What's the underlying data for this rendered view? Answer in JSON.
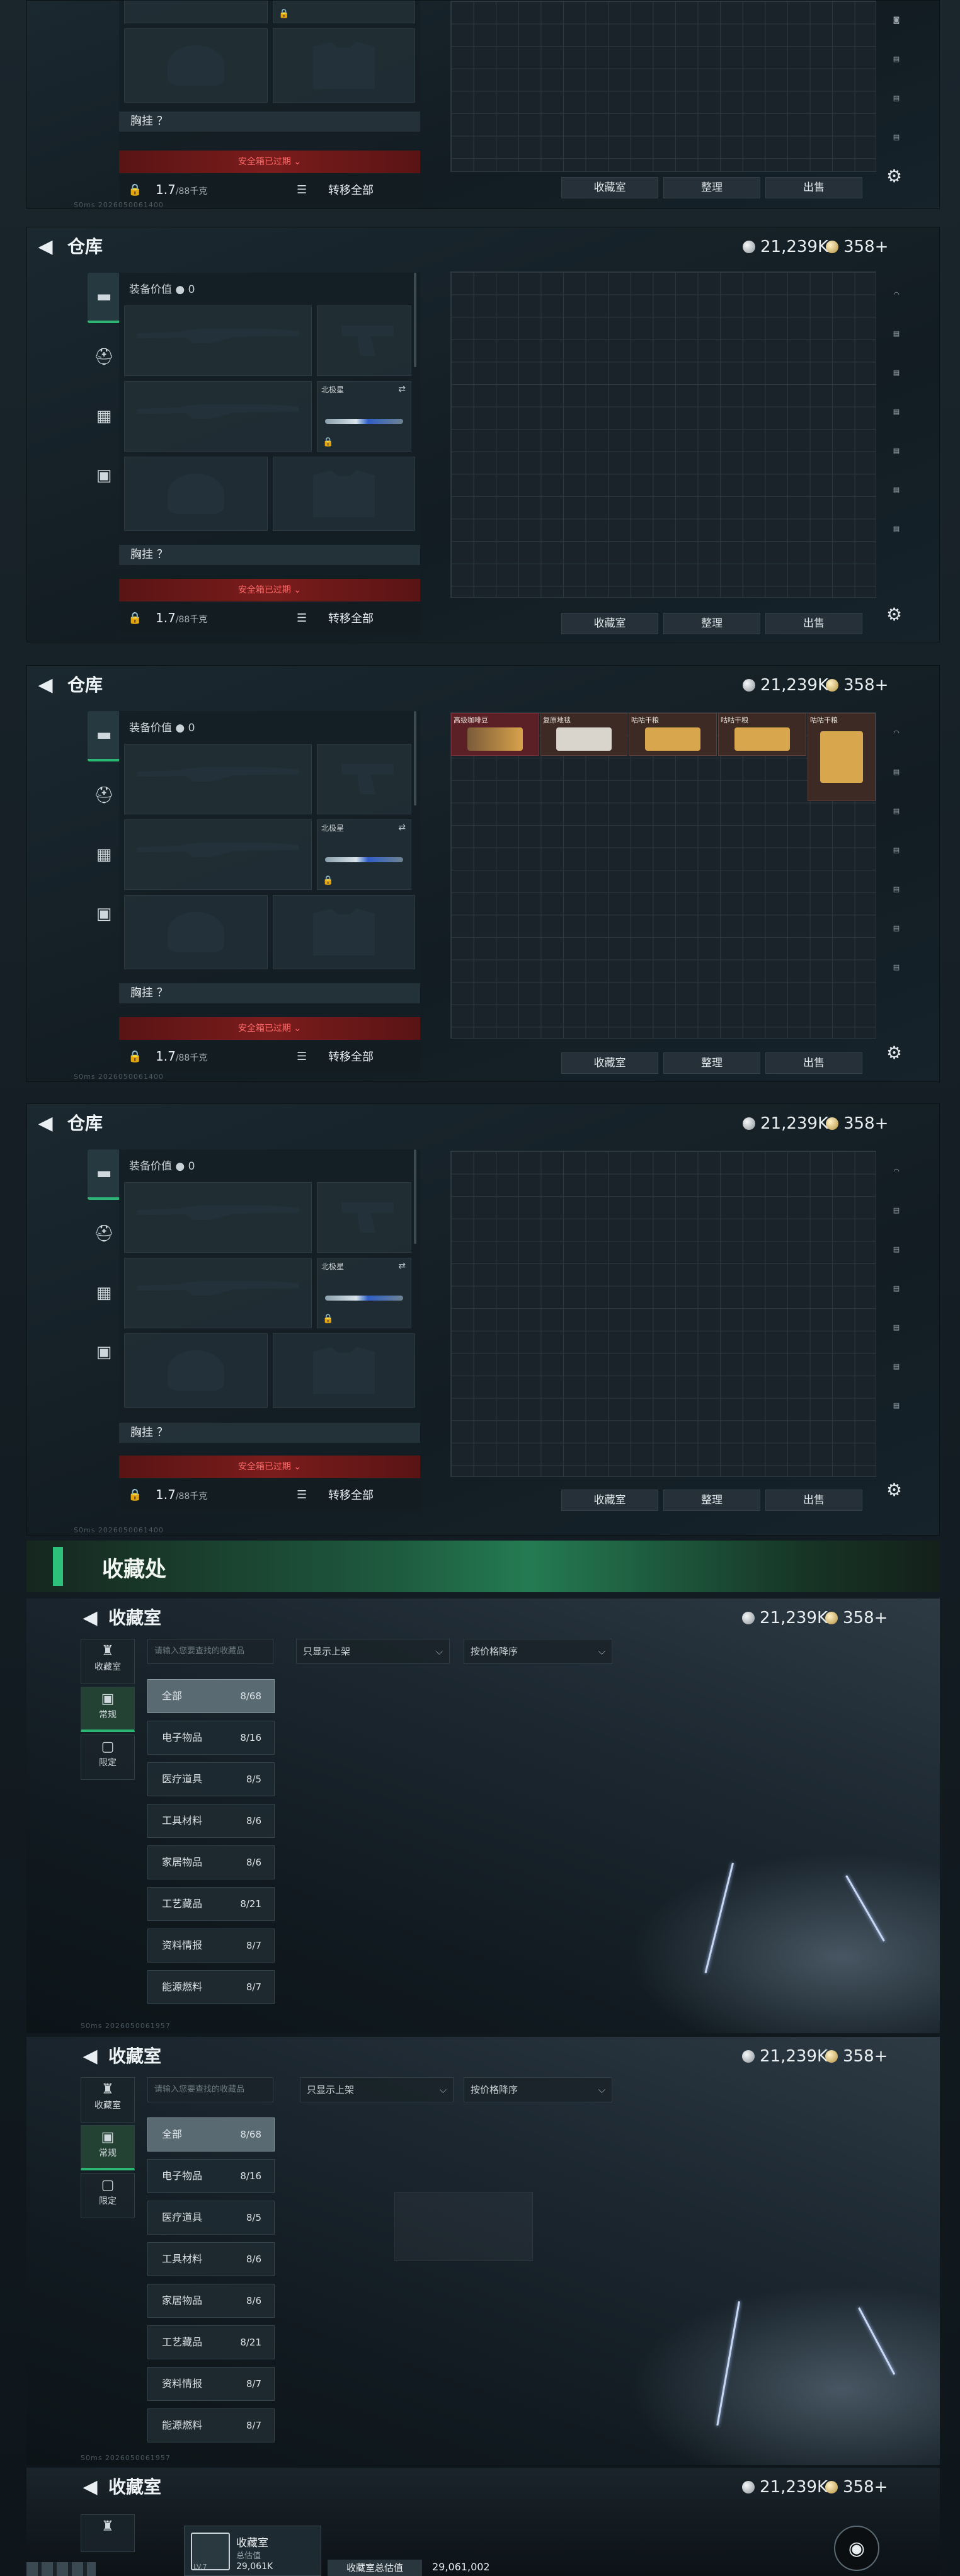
{
  "warehouse": {
    "title": "仓库",
    "silver": "21,239K",
    "gold": "358+",
    "equip_value_label": "装备价值",
    "equip_value": "0",
    "secondary_slot_label": "北极星",
    "chest_rig_label": "胸挂 ？",
    "safebox_alert": "安全箱已过期",
    "capacity": "1.7",
    "capacity_unit": "/88千克",
    "transfer_all": "转移全部",
    "btn_collection": "收藏室",
    "btn_sort": "整理",
    "btn_sell": "出售",
    "watermark": "S0ms 2026050061400"
  },
  "loot_items": [
    {
      "name": "高级咖啡豆"
    },
    {
      "name": "复原地毯"
    },
    {
      "name": "咕咕干粮"
    },
    {
      "name": "咕咕干粮"
    },
    {
      "name": "咕咕干粮"
    }
  ],
  "section_header": {
    "title": "收藏处"
  },
  "collection": {
    "title": "收藏室",
    "silver": "21,239K",
    "gold": "358+",
    "tabs": [
      {
        "label": "收藏室",
        "icon": "trophy-icon"
      },
      {
        "label": "常规",
        "icon": "image-icon"
      },
      {
        "label": "限定",
        "icon": "frame-icon"
      }
    ],
    "search_placeholder": "请输入您要查找的收藏品",
    "filter_shelf": "只显示上架",
    "sort_order": "按价格降序",
    "categories": [
      {
        "name": "全部",
        "count": "8/68"
      },
      {
        "name": "电子物品",
        "count": "8/16"
      },
      {
        "name": "医疗道具",
        "count": "8/5"
      },
      {
        "name": "工具材料",
        "count": "8/6"
      },
      {
        "name": "家居物品",
        "count": "8/6"
      },
      {
        "name": "工艺藏品",
        "count": "8/21"
      },
      {
        "name": "资料情报",
        "count": "8/7"
      },
      {
        "name": "能源燃料",
        "count": "8/7"
      }
    ],
    "watermark": "S0ms 2026050061957"
  },
  "final": {
    "title": "收藏室",
    "tile_name": "收藏室",
    "tile_sub": "总估值",
    "tile_value": "29,061K",
    "total_label": "收藏室总估值",
    "total_value": "29,061,002",
    "level_tag": "LV.7"
  }
}
